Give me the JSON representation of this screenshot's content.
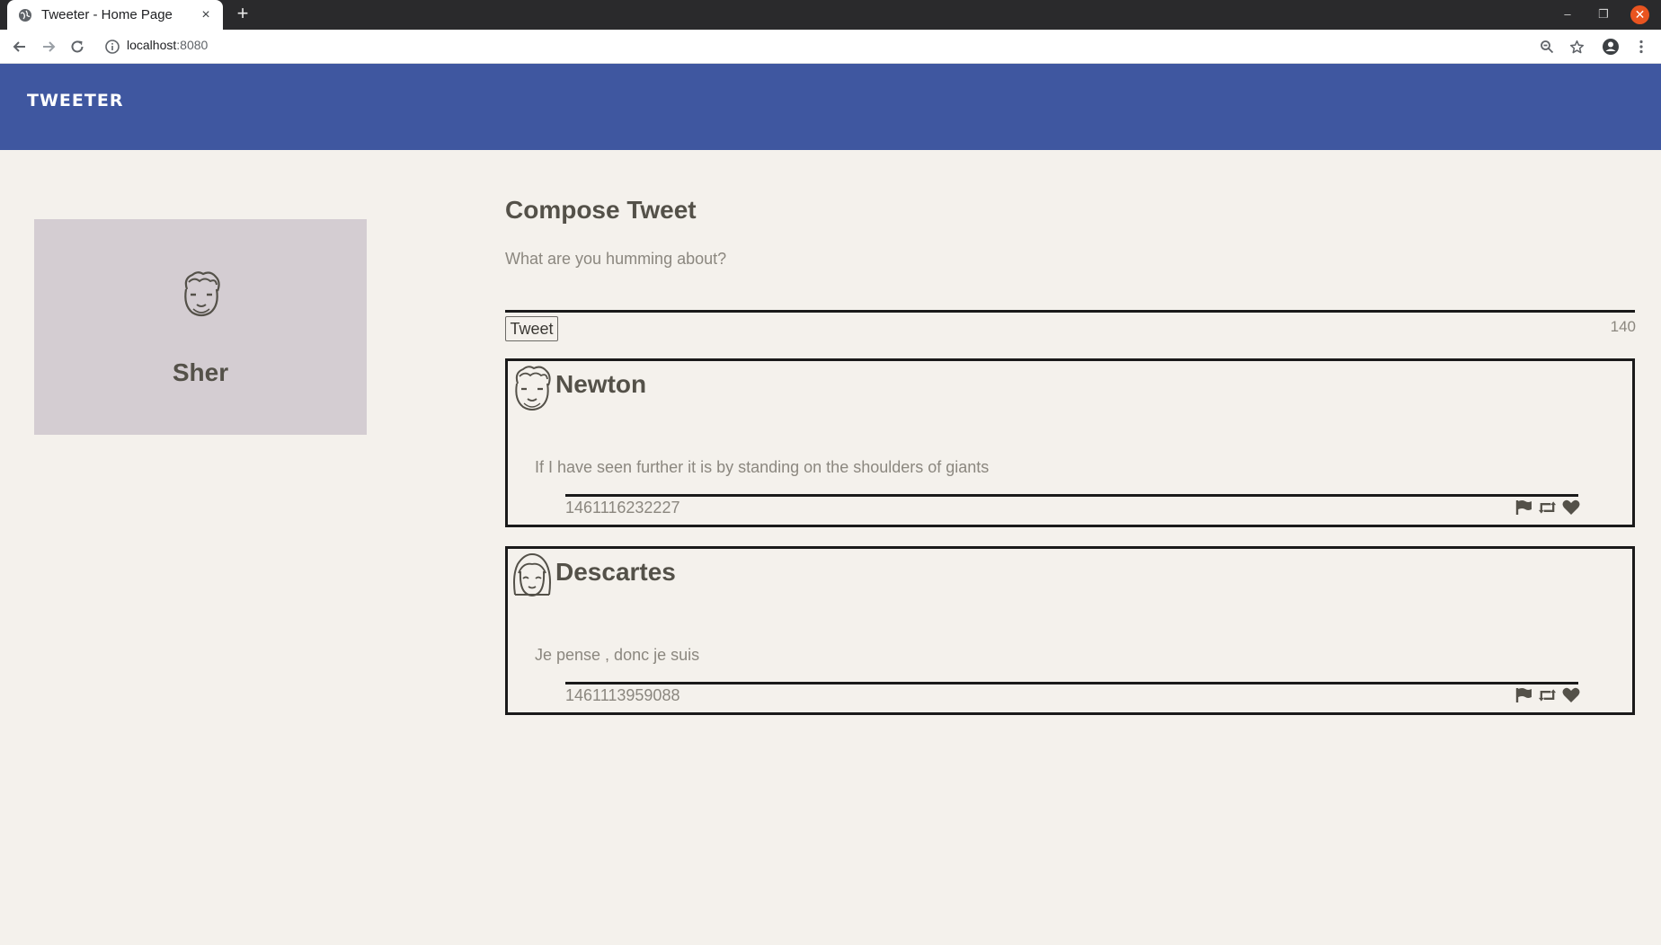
{
  "browser": {
    "tab_title": "Tweeter - Home Page",
    "tab_close": "×",
    "new_tab": "+",
    "url_host": "localhost",
    "url_port": ":8080",
    "window_min": "–",
    "window_max": "❐",
    "window_close": "✕"
  },
  "header": {
    "brand": "TWEETER",
    "color": "#3f57a0"
  },
  "profile": {
    "name": "Sher",
    "avatar_icon": "curly-hair-face-icon"
  },
  "compose": {
    "title": "Compose Tweet",
    "placeholder": "What are you humming about?",
    "button_label": "Tweet",
    "counter": "140"
  },
  "tweets": [
    {
      "name": "Newton",
      "avatar_icon": "curly-hair-face-icon",
      "text": "If I have seen further it is by standing on the shoulders of giants",
      "timestamp": "1461116232227",
      "actions": [
        "flag-icon",
        "retweet-icon",
        "heart-icon"
      ]
    },
    {
      "name": "Descartes",
      "avatar_icon": "long-hair-face-icon",
      "text": "Je pense , donc je suis",
      "timestamp": "1461113959088",
      "actions": [
        "flag-icon",
        "retweet-icon",
        "heart-icon"
      ]
    }
  ],
  "colors": {
    "page_bg": "#f4f1ec",
    "profile_bg": "#d4cdd2",
    "text": "#545149",
    "muted_text": "#8b877f"
  }
}
